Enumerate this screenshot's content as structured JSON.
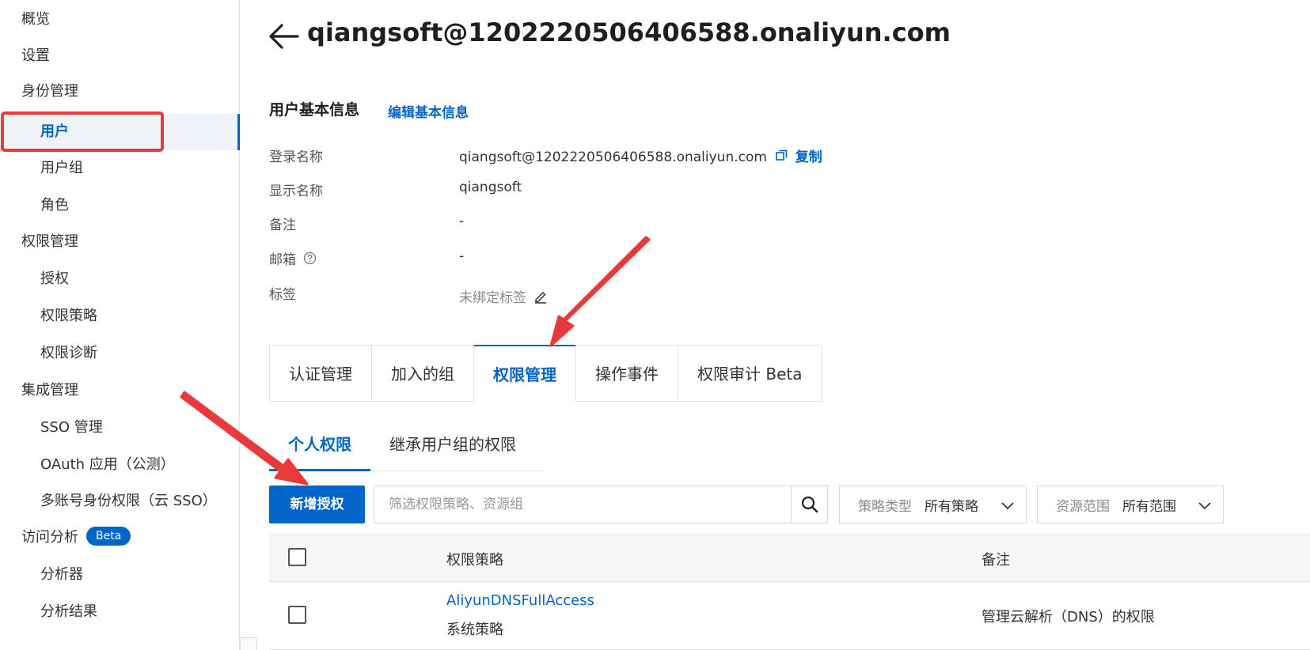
{
  "sidebar": {
    "items": [
      {
        "label": "概览",
        "level": 1
      },
      {
        "label": "设置",
        "level": 1
      },
      {
        "label": "身份管理",
        "level": 1
      },
      {
        "label": "用户",
        "level": 2,
        "active": true
      },
      {
        "label": "用户组",
        "level": 2
      },
      {
        "label": "角色",
        "level": 2
      },
      {
        "label": "权限管理",
        "level": 1
      },
      {
        "label": "授权",
        "level": 2
      },
      {
        "label": "权限策略",
        "level": 2
      },
      {
        "label": "权限诊断",
        "level": 2
      },
      {
        "label": "集成管理",
        "level": 1
      },
      {
        "label": "SSO 管理",
        "level": 2
      },
      {
        "label": "OAuth 应用（公测）",
        "level": 2
      },
      {
        "label": "多账号身份权限（云 SSO）",
        "level": 2
      },
      {
        "label": "访问分析",
        "level": 1,
        "badge": "Beta"
      },
      {
        "label": "分析器",
        "level": 2
      },
      {
        "label": "分析结果",
        "level": 2
      }
    ]
  },
  "header": {
    "title": "qiangsoft@1202220506406588.onaliyun.com"
  },
  "basic_info": {
    "section_title": "用户基本信息",
    "edit_link": "编辑基本信息",
    "login_name_label": "登录名称",
    "login_name_value": "qiangsoft@1202220506406588.onaliyun.com",
    "copy_label": "复制",
    "display_name_label": "显示名称",
    "display_name_value": "qiangsoft",
    "remark_label": "备注",
    "remark_value": "-",
    "email_label": "邮箱",
    "email_value": "-",
    "tag_label": "标签",
    "tag_value": "未绑定标签"
  },
  "tabs": [
    {
      "label": "认证管理"
    },
    {
      "label": "加入的组"
    },
    {
      "label": "权限管理",
      "active": true
    },
    {
      "label": "操作事件"
    },
    {
      "label": "权限审计 Beta"
    }
  ],
  "subtabs": [
    {
      "label": "个人权限",
      "active": true
    },
    {
      "label": "继承用户组的权限"
    }
  ],
  "toolbar": {
    "add_button": "新增授权",
    "search_placeholder": "筛选权限策略、资源组",
    "policy_type_label": "策略类型",
    "policy_type_value": "所有策略",
    "scope_label": "资源范围",
    "scope_value": "所有范围"
  },
  "table": {
    "columns": [
      "权限策略",
      "备注"
    ],
    "rows": [
      {
        "policy_name": "AliyunDNSFullAccess",
        "policy_type": "系统策略",
        "remark": "管理云解析（DNS）的权限"
      }
    ]
  },
  "colors": {
    "accent": "#0064c8",
    "highlight_red": "#e83a3a"
  }
}
